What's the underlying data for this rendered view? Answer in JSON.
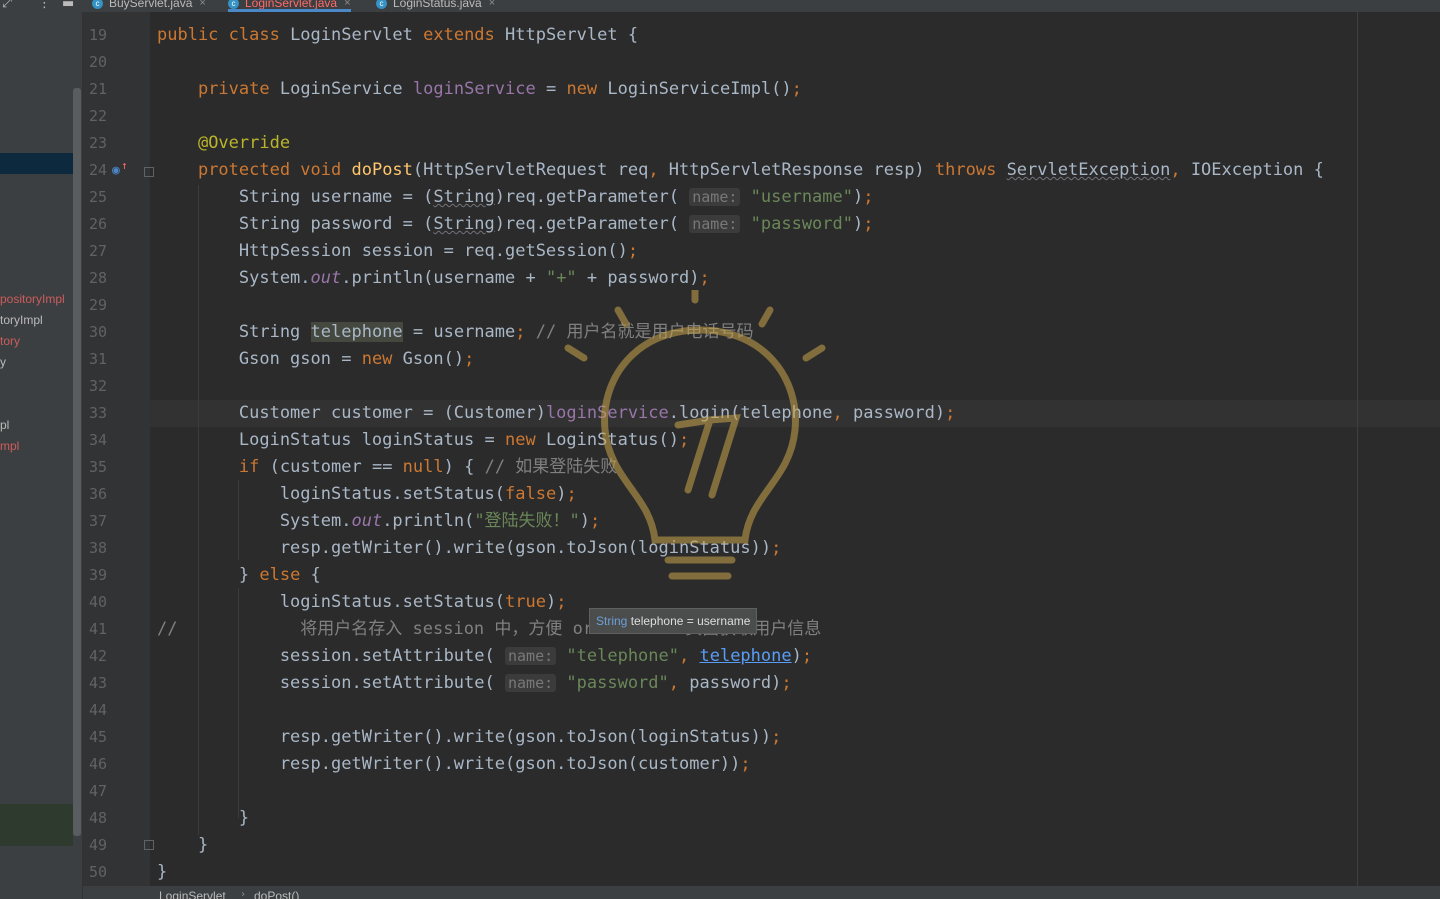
{
  "tabs": [
    {
      "label": "BuyServlet.java",
      "active": false
    },
    {
      "label": "LoginServlet.java",
      "active": true
    },
    {
      "label": "LoginStatus.java",
      "active": false
    }
  ],
  "sidebar": {
    "items": [
      "positoryImpl",
      "toryImpl",
      "tory",
      "y",
      "pl",
      "mpl"
    ]
  },
  "editor": {
    "line_numbers": [
      "19",
      "20",
      "21",
      "22",
      "23",
      "24",
      "25",
      "26",
      "27",
      "28",
      "29",
      "30",
      "31",
      "32",
      "33",
      "34",
      "35",
      "36",
      "37",
      "38",
      "39",
      "40",
      "41",
      "42",
      "43",
      "44",
      "45",
      "46",
      "47",
      "48",
      "49",
      "50"
    ]
  },
  "tooltip": {
    "type": "String",
    "text": " telephone = username"
  },
  "breadcrumb": {
    "class": "LoginServlet",
    "method": "doPost()"
  },
  "colors": {
    "keyword": "#cc7832",
    "string": "#6a8759",
    "field": "#9876aa",
    "method_decl": "#ffc66d",
    "annotation": "#bbb529",
    "comment": "#808080",
    "active_tab": "#ff6b68"
  },
  "icons": [
    "more-vert-icon",
    "minimize-icon",
    "class-file-icon",
    "implementing-method-icon",
    "watermark-bulb-icon"
  ]
}
